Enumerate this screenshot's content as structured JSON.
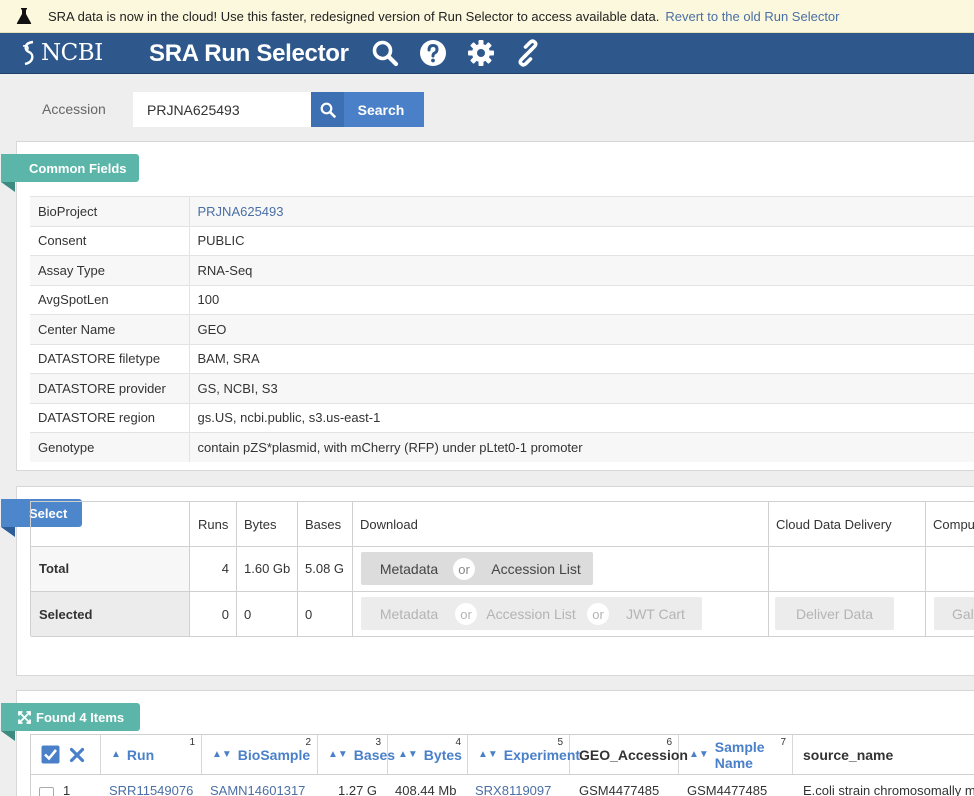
{
  "banner": {
    "icon": "flask-icon",
    "message": "SRA data is now in the cloud! Use this faster, redesigned version of Run Selector to access available data.",
    "link": "Revert to the old Run Selector"
  },
  "header": {
    "logo": "NCBI",
    "title": "SRA Run Selector",
    "icons": [
      "search-icon",
      "help-icon",
      "gear-icon",
      "link-icon"
    ]
  },
  "search": {
    "label": "Accession",
    "value": "PRJNA625493",
    "button": "Search"
  },
  "common_fields": {
    "tag": "Common Fields",
    "rows": [
      {
        "key": "BioProject",
        "value": "PRJNA625493"
      },
      {
        "key": "Consent",
        "value": "PUBLIC"
      },
      {
        "key": "Assay Type",
        "value": "RNA-Seq"
      },
      {
        "key": "AvgSpotLen",
        "value": "100"
      },
      {
        "key": "Center Name",
        "value": "GEO"
      },
      {
        "key": "DATASTORE filetype",
        "value": "BAM, SRA"
      },
      {
        "key": "DATASTORE provider",
        "value": "GS, NCBI, S3"
      },
      {
        "key": "DATASTORE region",
        "value": "gs.US, ncbi.public, s3.us-east-1"
      },
      {
        "key": "Genotype",
        "value": "contain pZS*plasmid, with mCherry (RFP) under pLtet0-1 promoter"
      }
    ]
  },
  "select": {
    "tag": "Select",
    "headers": {
      "runs": "Runs",
      "bytes": "Bytes",
      "bases": "Bases",
      "download": "Download",
      "cloud": "Cloud Data Delivery",
      "compute": "Compu"
    },
    "total": {
      "label": "Total",
      "runs": "4",
      "bytes": "1.60 Gb",
      "bases": "5.08 G",
      "metadata": "Metadata",
      "or": "or",
      "accession_list": "Accession List"
    },
    "selected": {
      "label": "Selected",
      "runs": "0",
      "bytes": "0",
      "bases": "0",
      "metadata": "Metadata",
      "or1": "or",
      "accession_list": "Accession List",
      "or2": "or",
      "jwt_cart": "JWT Cart",
      "deliver": "Deliver Data",
      "galaxy": "Gala"
    }
  },
  "results": {
    "tag": "Found 4 Items",
    "tag_icon": "expand-icon",
    "columns": [
      {
        "label": "Run",
        "num": "1"
      },
      {
        "label": "BioSample",
        "num": "2"
      },
      {
        "label": "Bases",
        "num": "3"
      },
      {
        "label": "Bytes",
        "num": "4"
      },
      {
        "label": "Experiment",
        "num": "5"
      },
      {
        "label": "GEO_Accession",
        "num": "6"
      },
      {
        "label": "Sample Name",
        "num": "7"
      },
      {
        "label": "source_name",
        "num": ""
      }
    ],
    "first_row": {
      "index": "1",
      "run": "SRR11549076",
      "biosample": "SAMN14601317",
      "bases": "1.27 G",
      "bytes": "408.44 Mb",
      "experiment": "SRX8119097",
      "geo": "GSM4477485",
      "sample_name": "GSM4477485",
      "source": "E.coli strain chromosomally m"
    }
  }
}
